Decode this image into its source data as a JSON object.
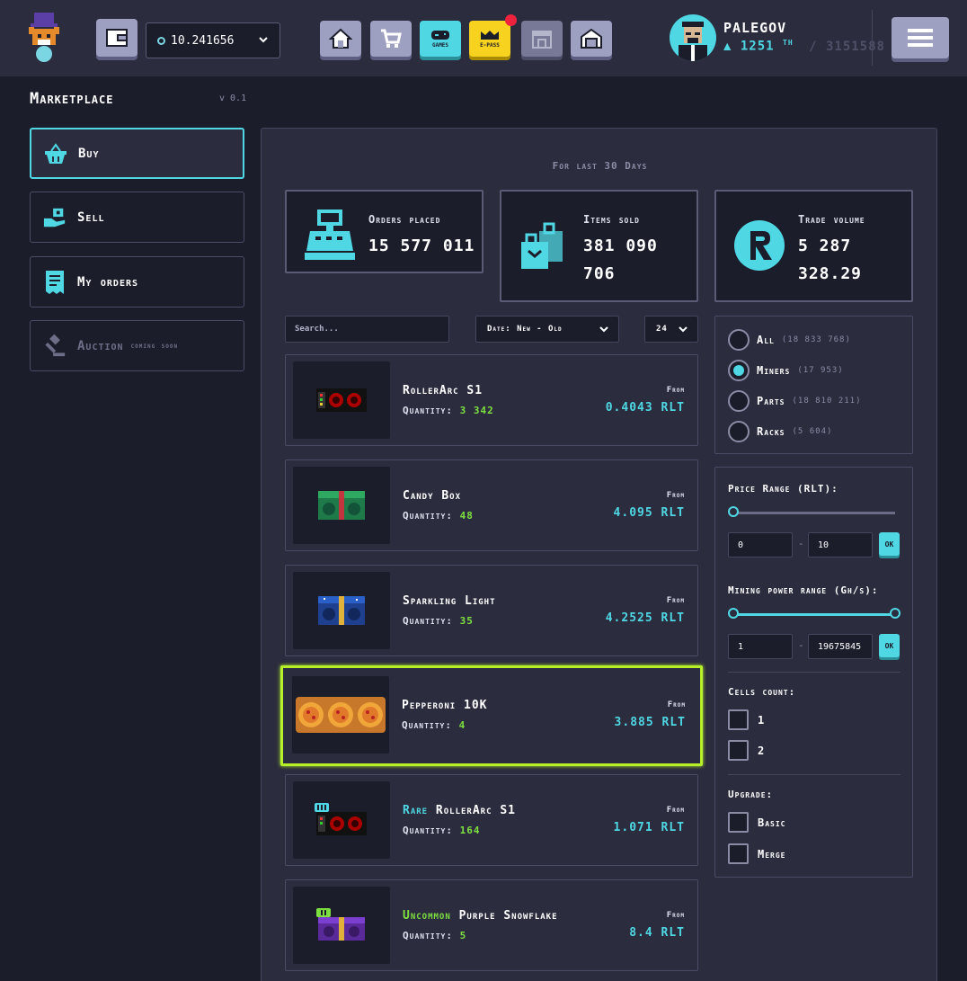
{
  "header": {
    "balance": "10.241656",
    "username": "PALEGOV",
    "power_value": "1251",
    "power_unit": "TH",
    "power_total": "/ 3151588",
    "nav": {
      "games_label": "GAMES",
      "epass_label": "E-PASS"
    }
  },
  "sidebar": {
    "title": "Marketplace",
    "version": "v 0.1",
    "items": [
      {
        "label": "Buy"
      },
      {
        "label": "Sell"
      },
      {
        "label": "My orders"
      },
      {
        "label": "Auction",
        "tag": "coming soon"
      }
    ]
  },
  "stats": {
    "period": "For last 30 Days",
    "orders": {
      "label": "Orders placed",
      "value": "15 577 011"
    },
    "items": {
      "label": "Items sold",
      "value": "381 090 706"
    },
    "volume": {
      "label": "Trade volume",
      "value": "5 287 328.29"
    }
  },
  "controls": {
    "search_placeholder": "Search...",
    "sort_value": "Date: New - Old",
    "per_page": "24"
  },
  "listings": [
    {
      "name": "RollerArc S1",
      "rarity_prefix": "",
      "qty_label": "Quantity:",
      "qty": "3 342",
      "from": "From",
      "price": "0.4043 RLT"
    },
    {
      "name": "Candy Box",
      "rarity_prefix": "",
      "qty_label": "Quantity:",
      "qty": "48",
      "from": "From",
      "price": "4.095 RLT"
    },
    {
      "name": "Sparkling Light",
      "rarity_prefix": "",
      "qty_label": "Quantity:",
      "qty": "35",
      "from": "From",
      "price": "4.2525 RLT"
    },
    {
      "name": "Pepperoni 10K",
      "rarity_prefix": "",
      "qty_label": "Quantity:",
      "qty": "4",
      "from": "From",
      "price": "3.885 RLT"
    },
    {
      "name": "RollerArc S1",
      "rarity_prefix": "Rare",
      "qty_label": "Quantity:",
      "qty": "164",
      "from": "From",
      "price": "1.071 RLT"
    },
    {
      "name": "Purple Snowflake",
      "rarity_prefix": "Uncommon",
      "qty_label": "Quantity:",
      "qty": "5",
      "from": "From",
      "price": "8.4 RLT"
    }
  ],
  "filters": {
    "categories": [
      {
        "label": "All",
        "count": "(18 833 768)",
        "selected": false
      },
      {
        "label": "Miners",
        "count": "(17 953)",
        "selected": true
      },
      {
        "label": "Parts",
        "count": "(18 810 211)",
        "selected": false
      },
      {
        "label": "Racks",
        "count": "(5 604)",
        "selected": false
      }
    ],
    "price_range": {
      "label": "Price Range (RLT):",
      "min": "0",
      "max": "10",
      "ok": "OK"
    },
    "power_range": {
      "label": "Mining power range (Gh/s):",
      "min": "1",
      "max": "19675845",
      "ok": "OK"
    },
    "cells": {
      "label": "Cells count:",
      "options": [
        "1",
        "2"
      ]
    },
    "upgrade": {
      "label": "Upgrade:",
      "options": [
        "Basic",
        "Merge"
      ]
    },
    "dash": "-"
  },
  "colors": {
    "accent": "#4fd8e4",
    "highlight": "#b6f02a",
    "quantity": "#7ee040",
    "background": "#1c1d2b",
    "panel": "#2b2c3e"
  }
}
